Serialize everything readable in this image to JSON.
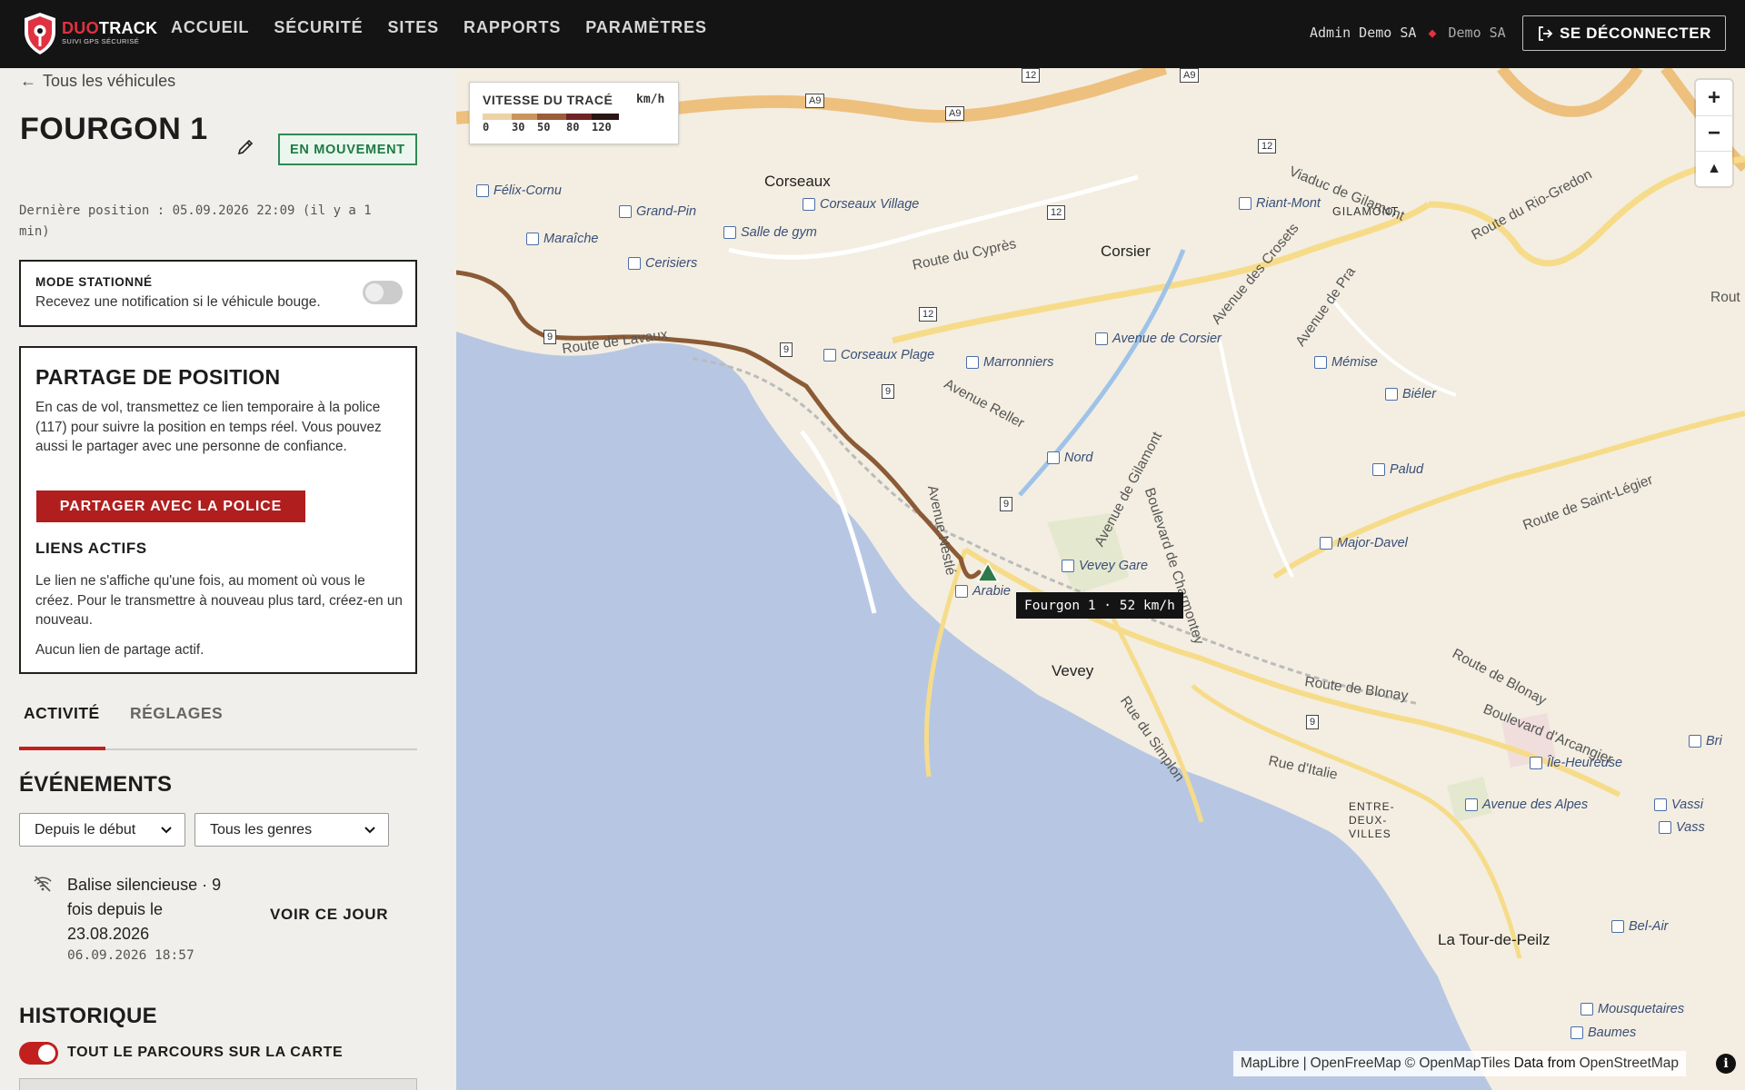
{
  "app": {
    "brand_duo": "DUO",
    "brand_track": "TRACK",
    "brand_tagline": "SUIVI GPS SÉCURISÉ"
  },
  "nav": {
    "items": [
      "ACCUEIL",
      "SÉCURITÉ",
      "SITES",
      "RAPPORTS",
      "PARAMÈTRES"
    ]
  },
  "account": {
    "user": "Admin Demo SA",
    "org": "Demo SA",
    "logout_label": "SE DÉCONNECTER"
  },
  "vehicle": {
    "back_label": "Tous les véhicules",
    "name": "FOURGON 1",
    "status": "EN MOUVEMENT",
    "last_position": "Dernière position : 05.09.2026 22:09 (il y a 1 min)"
  },
  "parked_mode": {
    "title": "MODE STATIONNÉ",
    "description": "Recevez une notification si le véhicule bouge.",
    "enabled": false
  },
  "share": {
    "title": "PARTAGE DE POSITION",
    "description": "En cas de vol, transmettez ce lien temporaire à la police (117) pour suivre la position en temps réel. Vous pouvez aussi le partager avec une personne de confiance.",
    "button_label": "PARTAGER AVEC LA POLICE",
    "active_links_title": "LIENS ACTIFS",
    "active_links_note": "Le lien ne s'affiche qu'une fois, au moment où vous le créez. Pour le transmettre à nouveau plus tard, créez-en un nouveau.",
    "no_links": "Aucun lien de partage actif."
  },
  "tabs": [
    {
      "label": "ACTIVITÉ",
      "active": true
    },
    {
      "label": "RÉGLAGES",
      "active": false
    }
  ],
  "events": {
    "title": "ÉVÉNEMENTS",
    "period_filter": "Depuis le début",
    "type_filter": "Tous les genres",
    "items": [
      {
        "icon": "wifi-off-icon",
        "text": "Balise silencieuse · 9 fois depuis le 23.08.2026",
        "timestamp": "06.09.2026 18:57",
        "action": "VOIR CE JOUR"
      }
    ]
  },
  "history": {
    "title": "HISTORIQUE",
    "toggle_label": "TOUT LE PARCOURS SUR LA CARTE",
    "toggle_on": true
  },
  "map": {
    "legend": {
      "title": "VITESSE DU TRACÉ",
      "unit": "km/h",
      "ticks": [
        "0",
        "30",
        "50",
        "80",
        "120"
      ],
      "colors": [
        "#ecd2a6",
        "#c9955c",
        "#9a5c3a",
        "#6e2424",
        "#2a1515"
      ]
    },
    "zoom_in": "+",
    "zoom_out": "−",
    "compass": "▲",
    "vehicle_tooltip": "Fourgon 1 · 52 km/h",
    "track_color": "#8b5a36",
    "vehicle_marker_color": "#2f7a4b",
    "attribution": {
      "maplibre": "MapLibre",
      "openfreemap": "OpenFreeMap",
      "openmaptiles": "© OpenMapTiles",
      "data_from": "Data from",
      "osm": "OpenStreetMap"
    },
    "places": {
      "corseaux": "Corseaux",
      "corsier": "Corsier",
      "vevey": "Vevey",
      "tour_de_peilz": "La Tour-de-Peilz",
      "gilamont": "GILAMONT",
      "entre_deux_villes": "ENTRE-DEUX-VILLES"
    },
    "stops": {
      "felix_cornu": "Félix-Cornu",
      "grand_pin": "Grand-Pin",
      "maraiche": "Maraîche",
      "cerisiers": "Cerisiers",
      "salle_de_gym": "Salle de gym",
      "corseaux_village": "Corseaux Village",
      "corseaux_plage": "Corseaux Plage",
      "marronniers": "Marronniers",
      "avenue_de_corsier": "Avenue de Corsier",
      "riant_mont": "Riant-Mont",
      "memise": "Mémise",
      "bieler": "Biéler",
      "nord": "Nord",
      "palud": "Palud",
      "major_davel": "Major-Davel",
      "vevey_gare": "Vevey Gare",
      "arabie": "Arabie",
      "ile_heureuse": "Île-Heureuse",
      "avenue_des_alpes": "Avenue des Alpes",
      "bel_air": "Bel-Air",
      "mousquetaires": "Mousquetaires",
      "baumes": "Baumes",
      "vassin": "Vassi",
      "vass2": "Vass",
      "bri": "Bri"
    },
    "roads": {
      "route_du_cypres": "Route du Cyprès",
      "viaduc": "Viaduc de Gilamont",
      "route_rio_gredon": "Route du Rio-Gredon",
      "avenue_des_crosets": "Avenue des Crosets",
      "avenue_de_pra": "Avenue de Pra",
      "route_de_lavaux": "Route de Lavaux",
      "avenue_reller": "Avenue Reller",
      "avenue_nestle": "Avenue Nestlé",
      "avenue_de_gilamont": "Avenue de Gilamont",
      "boulevard_charmontey": "Boulevard de Charmontey",
      "route_saint_legier": "Route de Saint-Légier",
      "route_de_blonay": "Route de Blonay",
      "route_de_blonay2": "Route de Blonay",
      "boulevard_arcangier": "Boulevard d'Arcangier",
      "rue_du_simplon": "Rue du Simplon",
      "rue_d_italie": "Rue d'Italie",
      "route_trunc": "Rout"
    },
    "shields": {
      "a9_1": "A9",
      "a9_2": "A9",
      "a9_3": "A9",
      "r12_1": "12",
      "r12_2": "12",
      "r12_3": "12",
      "r12_4": "12",
      "r9_1": "9",
      "r9_2": "9",
      "r9_3": "9",
      "r9_4": "9",
      "r9_5": "9"
    }
  }
}
